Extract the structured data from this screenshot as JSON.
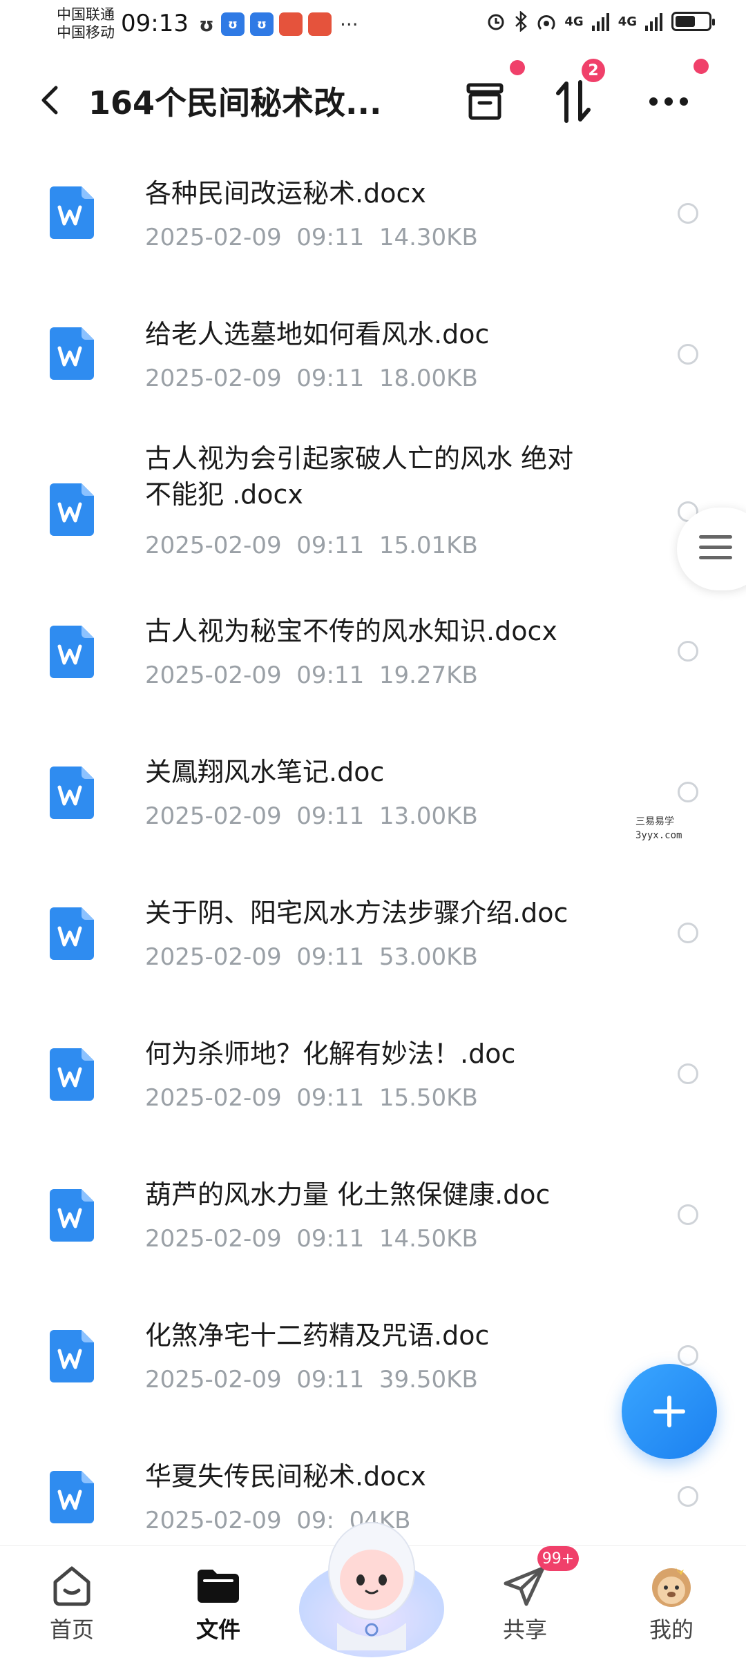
{
  "status_bar": {
    "carrier_1": "中国联通",
    "carrier_2": "中国移动",
    "time": "09:13",
    "dots": "···",
    "net_label_1": "4G",
    "net_label_2": "4G",
    "battery_level": 0.6
  },
  "header": {
    "title": "164个民间秘术改...",
    "sort_badge": "2"
  },
  "files": [
    {
      "name": "各种民间改运秘术.docx",
      "date": "2025-02-09",
      "time": "09:11",
      "size": "14.30KB"
    },
    {
      "name": "给老人选墓地如何看风水.doc",
      "date": "2025-02-09",
      "time": "09:11",
      "size": "18.00KB"
    },
    {
      "name_line1": "古人视为会引起家破人亡的风水 绝对",
      "name_line2": "不能犯 .docx",
      "date": "2025-02-09",
      "time": "09:11",
      "size": "15.01KB"
    },
    {
      "name": "古人视为秘宝不传的风水知识.docx",
      "date": "2025-02-09",
      "time": "09:11",
      "size": "19.27KB"
    },
    {
      "name": "关鳳翔风水笔记.doc",
      "date": "2025-02-09",
      "time": "09:11",
      "size": "13.00KB"
    },
    {
      "name": "关于阴、阳宅风水方法步骤介绍.doc",
      "date": "2025-02-09",
      "time": "09:11",
      "size": "53.00KB"
    },
    {
      "name": "何为杀师地？化解有妙法！.doc",
      "date": "2025-02-09",
      "time": "09:11",
      "size": "15.50KB"
    },
    {
      "name": "葫芦的风水力量 化土煞保健康.doc",
      "date": "2025-02-09",
      "time": "09:11",
      "size": "14.50KB"
    },
    {
      "name": "化煞净宅十二药精及咒语.doc",
      "date": "2025-02-09",
      "time": "09:11",
      "size": "39.50KB"
    },
    {
      "name": "华夏失传民间秘术.docx",
      "date": "2025-02-09",
      "time": "09:",
      "size": "04KB"
    }
  ],
  "watermark": {
    "line1": "三易易学",
    "line2": "3yyx.com"
  },
  "bottom_nav": {
    "home": "首页",
    "files": "文件",
    "share": "共享",
    "share_badge": "99+",
    "mine": "我的"
  },
  "colors": {
    "accent": "#1b80f0",
    "badge": "#f0406a",
    "doc_icon": "#2f8cf0"
  }
}
